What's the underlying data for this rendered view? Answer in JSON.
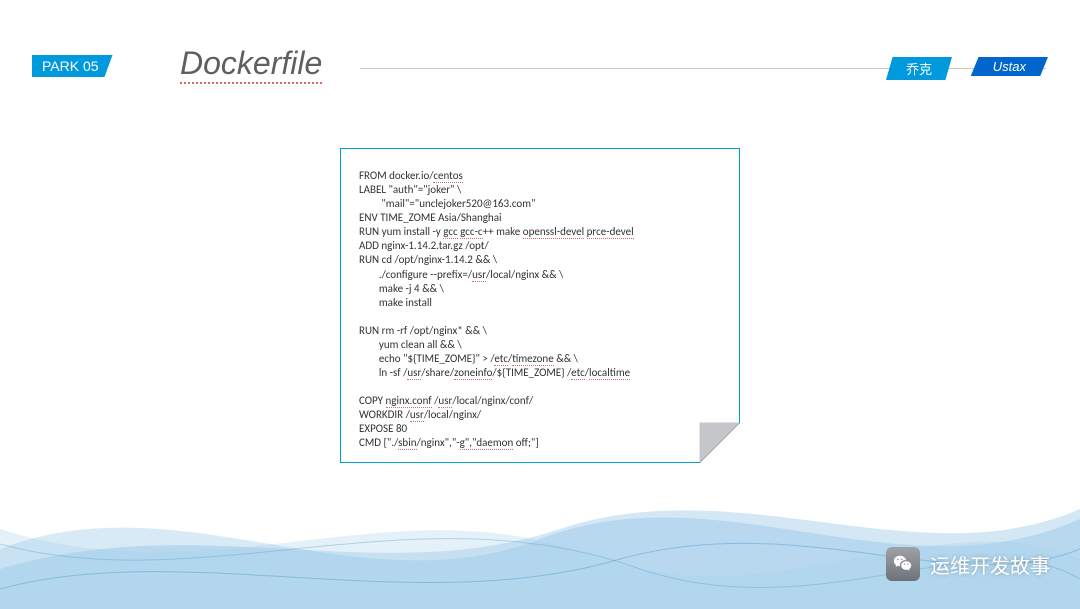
{
  "header": {
    "badge": "PARK 05",
    "title": "Dockerfile",
    "tag1": "乔克",
    "tag2": "Ustax"
  },
  "code": {
    "l01a": "FROM docker.io/",
    "l01b": "centos",
    "l02": "LABEL \"auth\"=\"joker\" \\",
    "l03": "         \"mail\"=\"unclejoker520@163.com\"",
    "l04": "ENV TIME_ZOME Asia/Shanghai",
    "l05a": "RUN yum install -y ",
    "l05b": "gcc",
    "l05c": " ",
    "l05d": "gcc-c",
    "l05e": "++ make ",
    "l05f": "openssl-devel",
    "l05g": " ",
    "l05h": "prce-devel",
    "l06": "ADD nginx-1.14.2.tar.gz /opt/",
    "l07": "RUN cd /opt/nginx-1.14.2 && \\",
    "l08a": "        ./configure --prefix=/",
    "l08b": "usr",
    "l08c": "/local/nginx && \\",
    "l09": "        make -j 4 && \\",
    "l10": "        make install",
    "blank": " ",
    "l12": "RUN rm -rf /opt/nginx* && \\",
    "l13": "        yum clean all && \\",
    "l14a": "        echo \"${TIME_ZOME}\" > /",
    "l14b": "etc",
    "l14c": "/",
    "l14d": "timezone",
    "l14e": " && \\",
    "l15a": "        ln -sf /",
    "l15b": "usr",
    "l15c": "/share/",
    "l15d": "zoneinfo",
    "l15e": "/${TIME_ZOME} /",
    "l15f": "etc",
    "l15g": "/",
    "l15h": "localtime",
    "l17a": "COPY ",
    "l17b": "nginx.conf",
    "l17c": " /",
    "l17d": "usr",
    "l17e": "/local/nginx/conf/",
    "l18a": "WORKDIR /",
    "l18b": "usr",
    "l18c": "/local/nginx/",
    "l19": "EXPOSE 80",
    "l20a": "CMD [\"./",
    "l20b": "sbin",
    "l20c": "/nginx\",\"-",
    "l20d": "g\",\"daemon",
    "l20e": " off;\"]"
  },
  "watermark": {
    "text": "运维开发故事"
  }
}
